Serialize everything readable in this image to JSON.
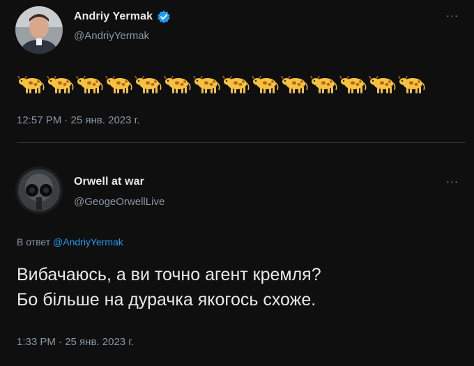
{
  "tweet1": {
    "display_name": "Andriy Yermak",
    "handle": "@AndriyYermak",
    "verified": true,
    "more": "···",
    "emoji_name": "cow-emoji",
    "emoji_count": 14,
    "timestamp": "12:57 PM · 25 янв. 2023 г."
  },
  "tweet2": {
    "display_name": "Orwell at war",
    "handle": "@GeogeOrwellLive",
    "more": "···",
    "reply_prefix": "В ответ",
    "reply_mention": "@AndriyYermak",
    "text_line1": "Вибачаюсь, а ви точно агент кремля?",
    "text_line2": "Бо більше на дурачка якогось схоже.",
    "timestamp": "1:33 PM · 25 янв. 2023 г."
  },
  "colors": {
    "background": "#0f0f0f",
    "text_primary": "#e7e9ea",
    "text_secondary": "#8b98a5",
    "accent": "#1d9bf0",
    "divider": "#2f3336"
  }
}
